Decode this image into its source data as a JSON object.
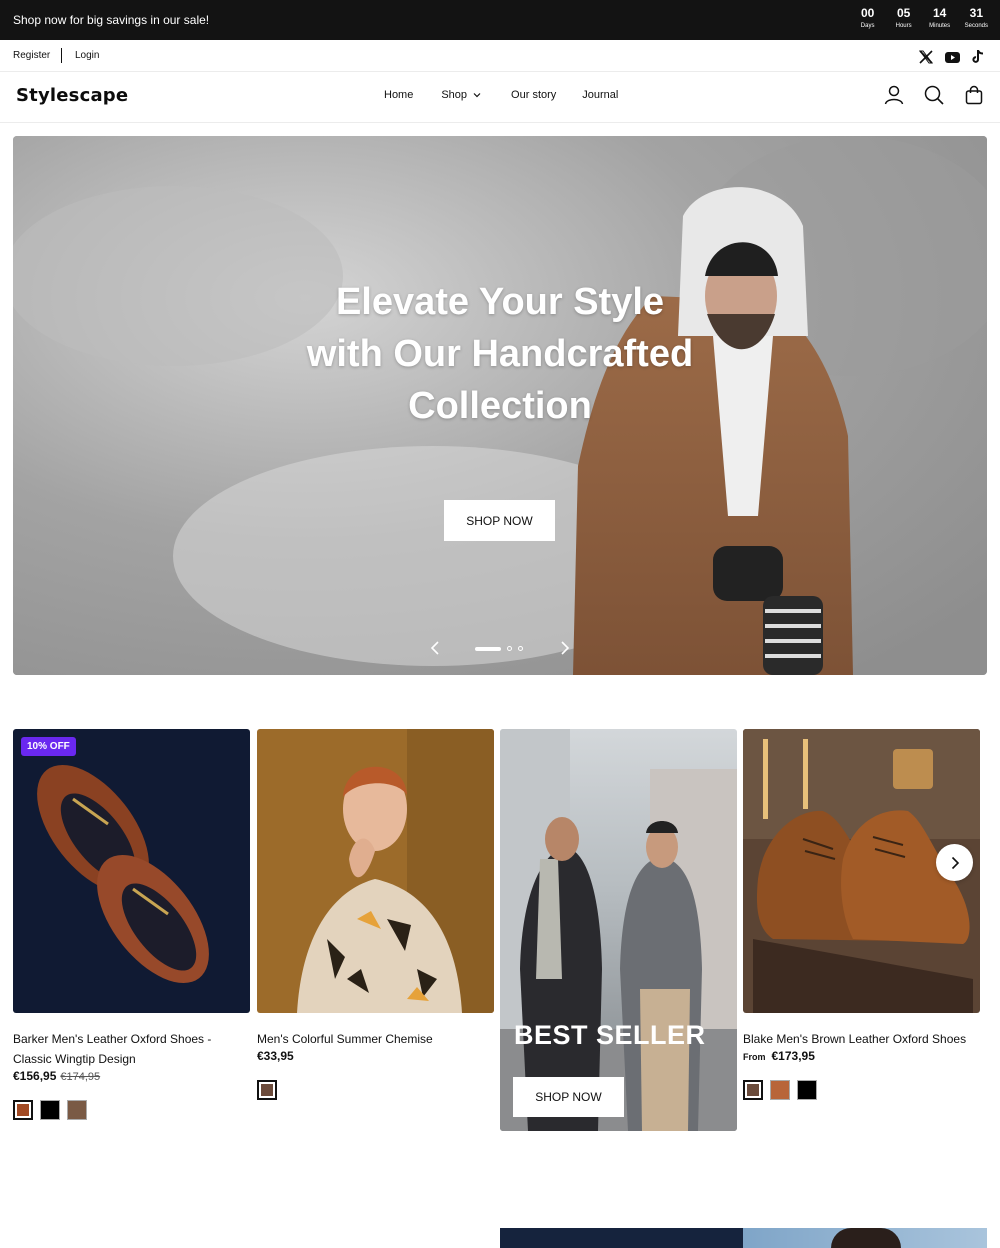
{
  "announcement": {
    "text": "Shop now for big savings in our sale!",
    "countdown": [
      {
        "value": "00",
        "label": "Days"
      },
      {
        "value": "05",
        "label": "Hours"
      },
      {
        "value": "14",
        "label": "Minutes"
      },
      {
        "value": "31",
        "label": "Seconds"
      }
    ]
  },
  "utility": {
    "register": "Register",
    "login": "Login",
    "socials": [
      "x-icon",
      "youtube-icon",
      "tiktok-icon"
    ]
  },
  "header": {
    "logo": "Stylescape",
    "nav": [
      {
        "label": "Home"
      },
      {
        "label": "Shop",
        "has_dropdown": true
      },
      {
        "label": "Our story"
      },
      {
        "label": "Journal"
      }
    ],
    "icons": [
      "account-icon",
      "search-icon",
      "cart-icon"
    ]
  },
  "hero": {
    "title": "Elevate Your Style with Our Handcrafted Collection",
    "button": "SHOP NOW",
    "slides": 3,
    "active_slide": 1
  },
  "products": [
    {
      "badge": "10% OFF",
      "title": "Barker Men's Leather Oxford Shoes - Classic Wingtip Design",
      "price": "€156,95",
      "old_price": "€174,95",
      "swatches": [
        "#a24a23",
        "#000000",
        "#7a5a45"
      ]
    },
    {
      "title": "Men's Colorful Summer Chemise",
      "price": "€33,95",
      "swatches": [
        "#6b4a3a"
      ]
    },
    {
      "title": "Blake Men's Brown Leather Oxford Shoes",
      "price_prefix": "From",
      "price": "€173,95",
      "swatches": [
        "#6a4b3b",
        "#b8653a",
        "#000000"
      ]
    }
  ],
  "promo": {
    "title": "BEST SELLER",
    "button": "SHOP NOW"
  },
  "colors": {
    "announcement_bg": "#131313",
    "badge": "#6a28f0"
  }
}
